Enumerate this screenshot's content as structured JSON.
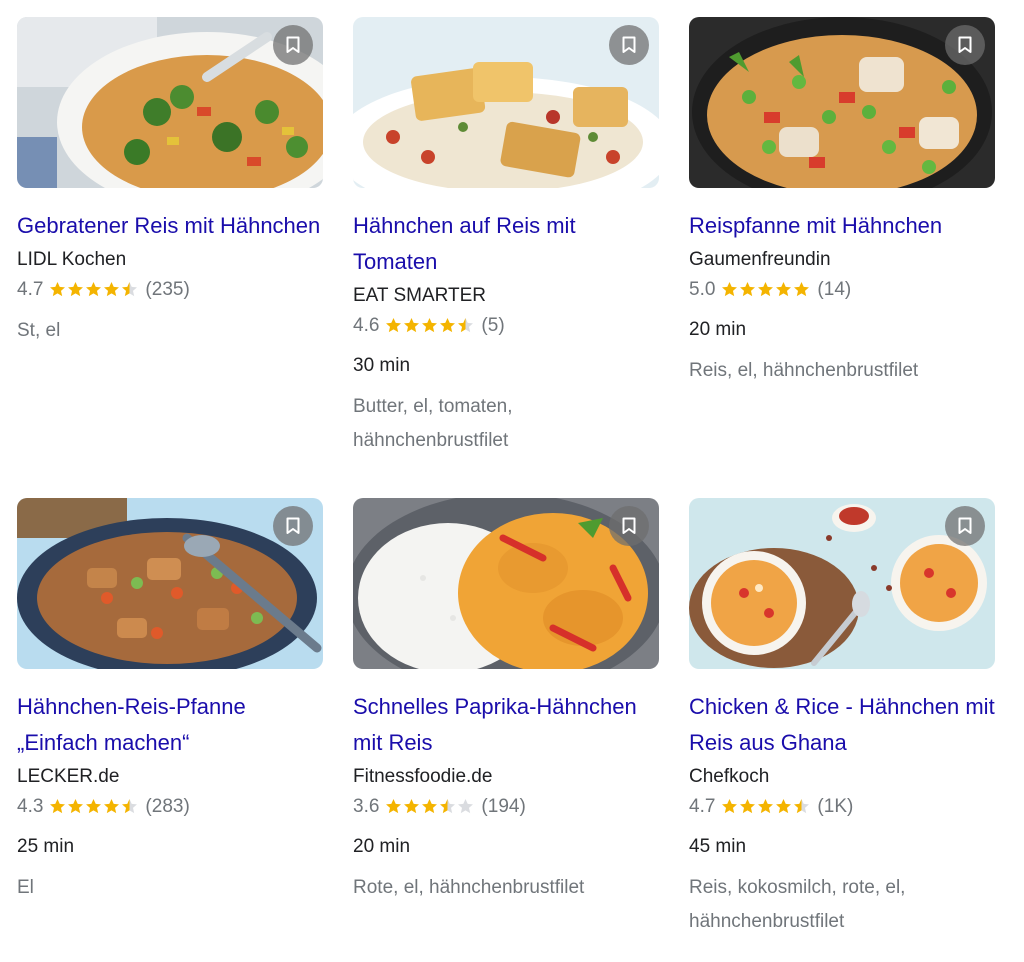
{
  "recipes": [
    {
      "title": "Gebratener Reis mit Hähnchen",
      "source": "LIDL Kochen",
      "rating": "4.7",
      "stars": 4.5,
      "reviews": "(235)",
      "time": "",
      "ingredients": "St, el",
      "image": "fried-rice-broccoli-image"
    },
    {
      "title": "Hähnchen auf Reis mit Tomaten",
      "source": "EAT SMARTER",
      "rating": "4.6",
      "stars": 4.5,
      "reviews": "(5)",
      "time": "30 min",
      "ingredients": "Butter, el, tomaten, hähnchenbrustfilet",
      "image": "chicken-on-rice-image"
    },
    {
      "title": "Reispfanne mit Hähnchen",
      "source": "Gaumenfreundin",
      "rating": "5.0",
      "stars": 5,
      "reviews": "(14)",
      "time": "20 min",
      "ingredients": "Reis, el, hähnchenbrustfilet",
      "image": "rice-pan-peas-image"
    },
    {
      "title": "Hähnchen-Reis-Pfanne „Einfach machen“",
      "source": "LECKER.de",
      "rating": "4.3",
      "stars": 4.5,
      "reviews": "(283)",
      "time": "25 min",
      "ingredients": "El",
      "image": "chicken-rice-pan-image"
    },
    {
      "title": "Schnelles Paprika-Hähnchen mit Reis",
      "source": "Fitnessfoodie.de",
      "rating": "3.6",
      "stars": 3.5,
      "reviews": "(194)",
      "time": "20 min",
      "ingredients": "Rote, el, hähnchenbrustfilet",
      "image": "paprika-chicken-rice-image"
    },
    {
      "title": "Chicken & Rice - Hähnchen mit Reis aus Ghana",
      "source": "Chefkoch",
      "rating": "4.7",
      "stars": 4.5,
      "reviews": "(1K)",
      "time": "45 min",
      "ingredients": "Reis, kokosmilch, rote, el, hähnchenbrustfilet",
      "image": "ghana-curry-bowls-image"
    }
  ],
  "colors": {
    "title_link": "#1a0dab",
    "star_filled": "#f4b400",
    "star_empty": "#dadce0",
    "secondary_text": "#70757a"
  },
  "icons": {
    "bookmark": "bookmark-icon",
    "star": "star-icon"
  }
}
